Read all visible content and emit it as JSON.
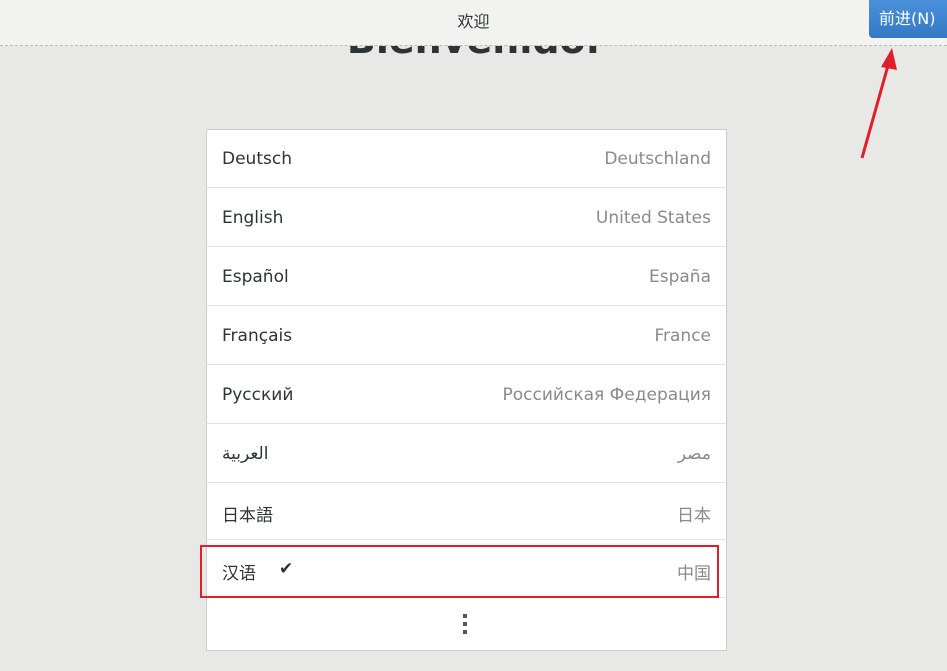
{
  "header": {
    "title": "欢迎",
    "next_label": "前进(N)"
  },
  "welcome_text": "Bienvenido.",
  "languages": [
    {
      "name": "Deutsch",
      "region": "Deutschland"
    },
    {
      "name": "English",
      "region": "United States"
    },
    {
      "name": "Español",
      "region": "España"
    },
    {
      "name": "Français",
      "region": "France"
    },
    {
      "name": "Русский",
      "region": "Российская Федерация"
    },
    {
      "name": "العربية",
      "region": "مصر"
    },
    {
      "name": "日本語",
      "region": "日本"
    },
    {
      "name": "汉语",
      "region": "中国",
      "selected": true,
      "check": "✔"
    }
  ],
  "icons": {
    "more": "more-vertical-icon",
    "check": "checkmark-icon"
  },
  "colors": {
    "accent": "#3b85d1",
    "highlight": "#e01f2b"
  }
}
